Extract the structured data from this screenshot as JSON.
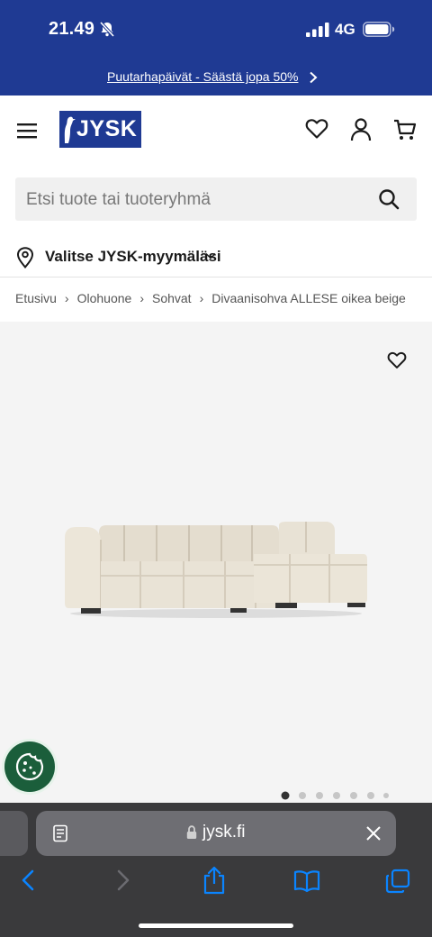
{
  "status_bar": {
    "time": "21.49",
    "network": "4G",
    "icons": [
      "bell-muted-icon",
      "signal-icon",
      "battery-icon"
    ]
  },
  "promo": {
    "text": "Puutarhapäivät - Säästä jopa 50%"
  },
  "header": {
    "logo_text": "JYSK",
    "icons": [
      "menu-icon",
      "heart-icon",
      "user-icon",
      "cart-icon"
    ]
  },
  "search": {
    "placeholder": "Etsi tuote tai tuoteryhmä"
  },
  "store": {
    "label": "Valitse JYSK-myymäläsi"
  },
  "breadcrumb": [
    "Etusivu",
    "Olohuone",
    "Sohvat",
    "Divaanisohva ALLESE oikea beige"
  ],
  "product_gallery": {
    "image_count": 7,
    "active_index": 0
  },
  "browser": {
    "url": "jysk.fi"
  },
  "colors": {
    "brand_blue": "#1f3a93",
    "cookie_green": "#1b5e3b",
    "browser_accent": "#0a84ff",
    "toolbar_bg": "#3a3a3c"
  }
}
